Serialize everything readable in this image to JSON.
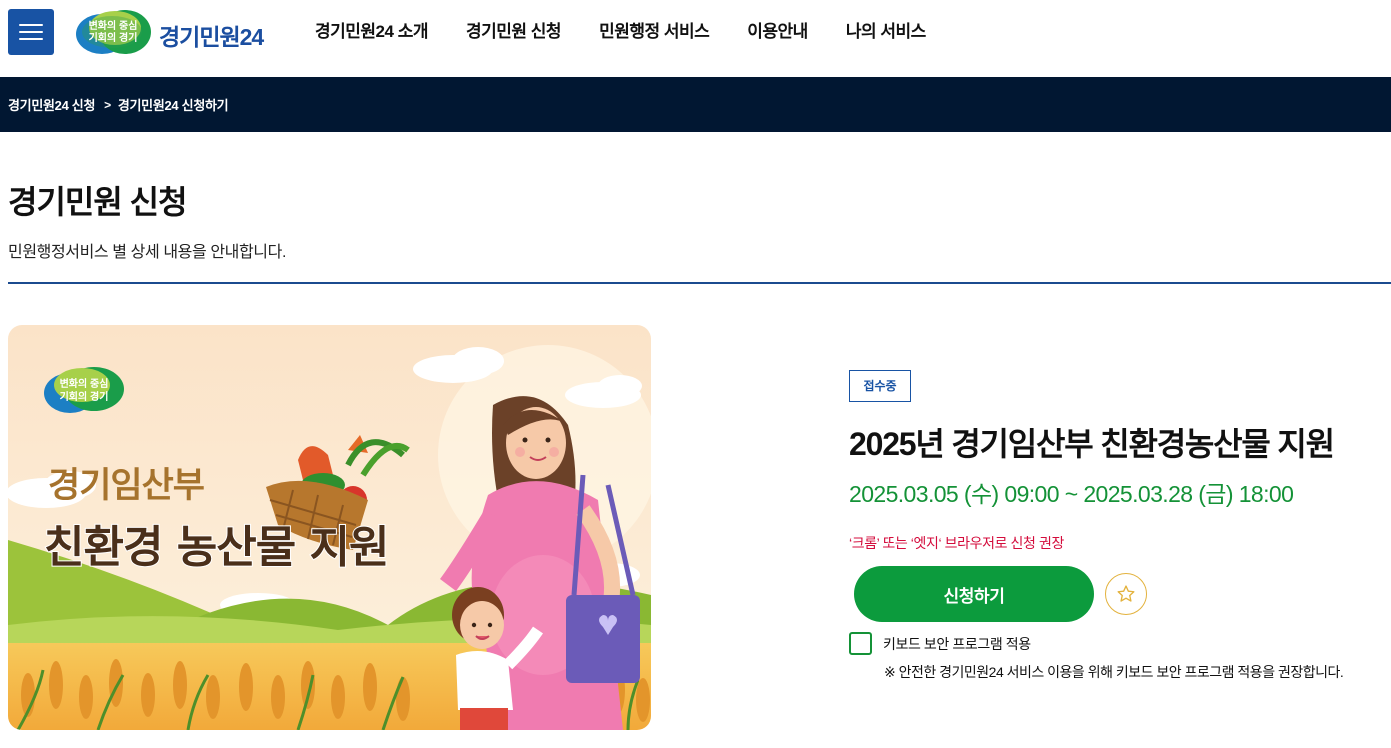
{
  "header": {
    "logo": {
      "emblem_line1": "변화의 중심",
      "emblem_line2": "기회의 경기",
      "name": "경기민원24"
    },
    "nav": [
      "경기민원24 소개",
      "경기민원 신청",
      "민원행정 서비스",
      "이용안내",
      "나의 서비스"
    ]
  },
  "breadcrumb": {
    "items": [
      "경기민원24 신청",
      "경기민원24 신청하기"
    ],
    "separator": ">"
  },
  "page": {
    "title": "경기민원 신청",
    "description": "민원행정서비스 별 상세 내용을 안내합니다."
  },
  "banner": {
    "emblem_line1": "변화의 중심",
    "emblem_line2": "기회의 경기",
    "headline_line1": "경기임산부",
    "headline_line2": "친환경 농산물 지원"
  },
  "service": {
    "status_badge": "접수중",
    "title": "2025년 경기임산부 친환경농산물 지원",
    "period": "2025.03.05 (수) 09:00 ~ 2025.03.28 (금) 18:00",
    "browser_note": "‘크롬’ 또는 ‘엣지‘ 브라우저로 신청 권장",
    "apply_label": "신청하기",
    "keyboard_security_label": "키보드 보안 프로그램 적용",
    "keyboard_security_checked": false,
    "keyboard_security_note": "※ 안전한 경기민원24 서비스 이용을 위해 키보드 보안 프로그램 적용을 권장합니다."
  },
  "colors": {
    "brand_blue": "#1853a4",
    "breadcrumb_bg": "#011732",
    "accent_green": "#0c9b3d",
    "period_green": "#149237",
    "warning_red": "#d40c3c",
    "star_gold": "#e3b23d"
  },
  "icons": {
    "menu": "hamburger-menu-icon",
    "favorite": "star-outline-icon",
    "crumb_separator": "chevron-right-icon"
  }
}
